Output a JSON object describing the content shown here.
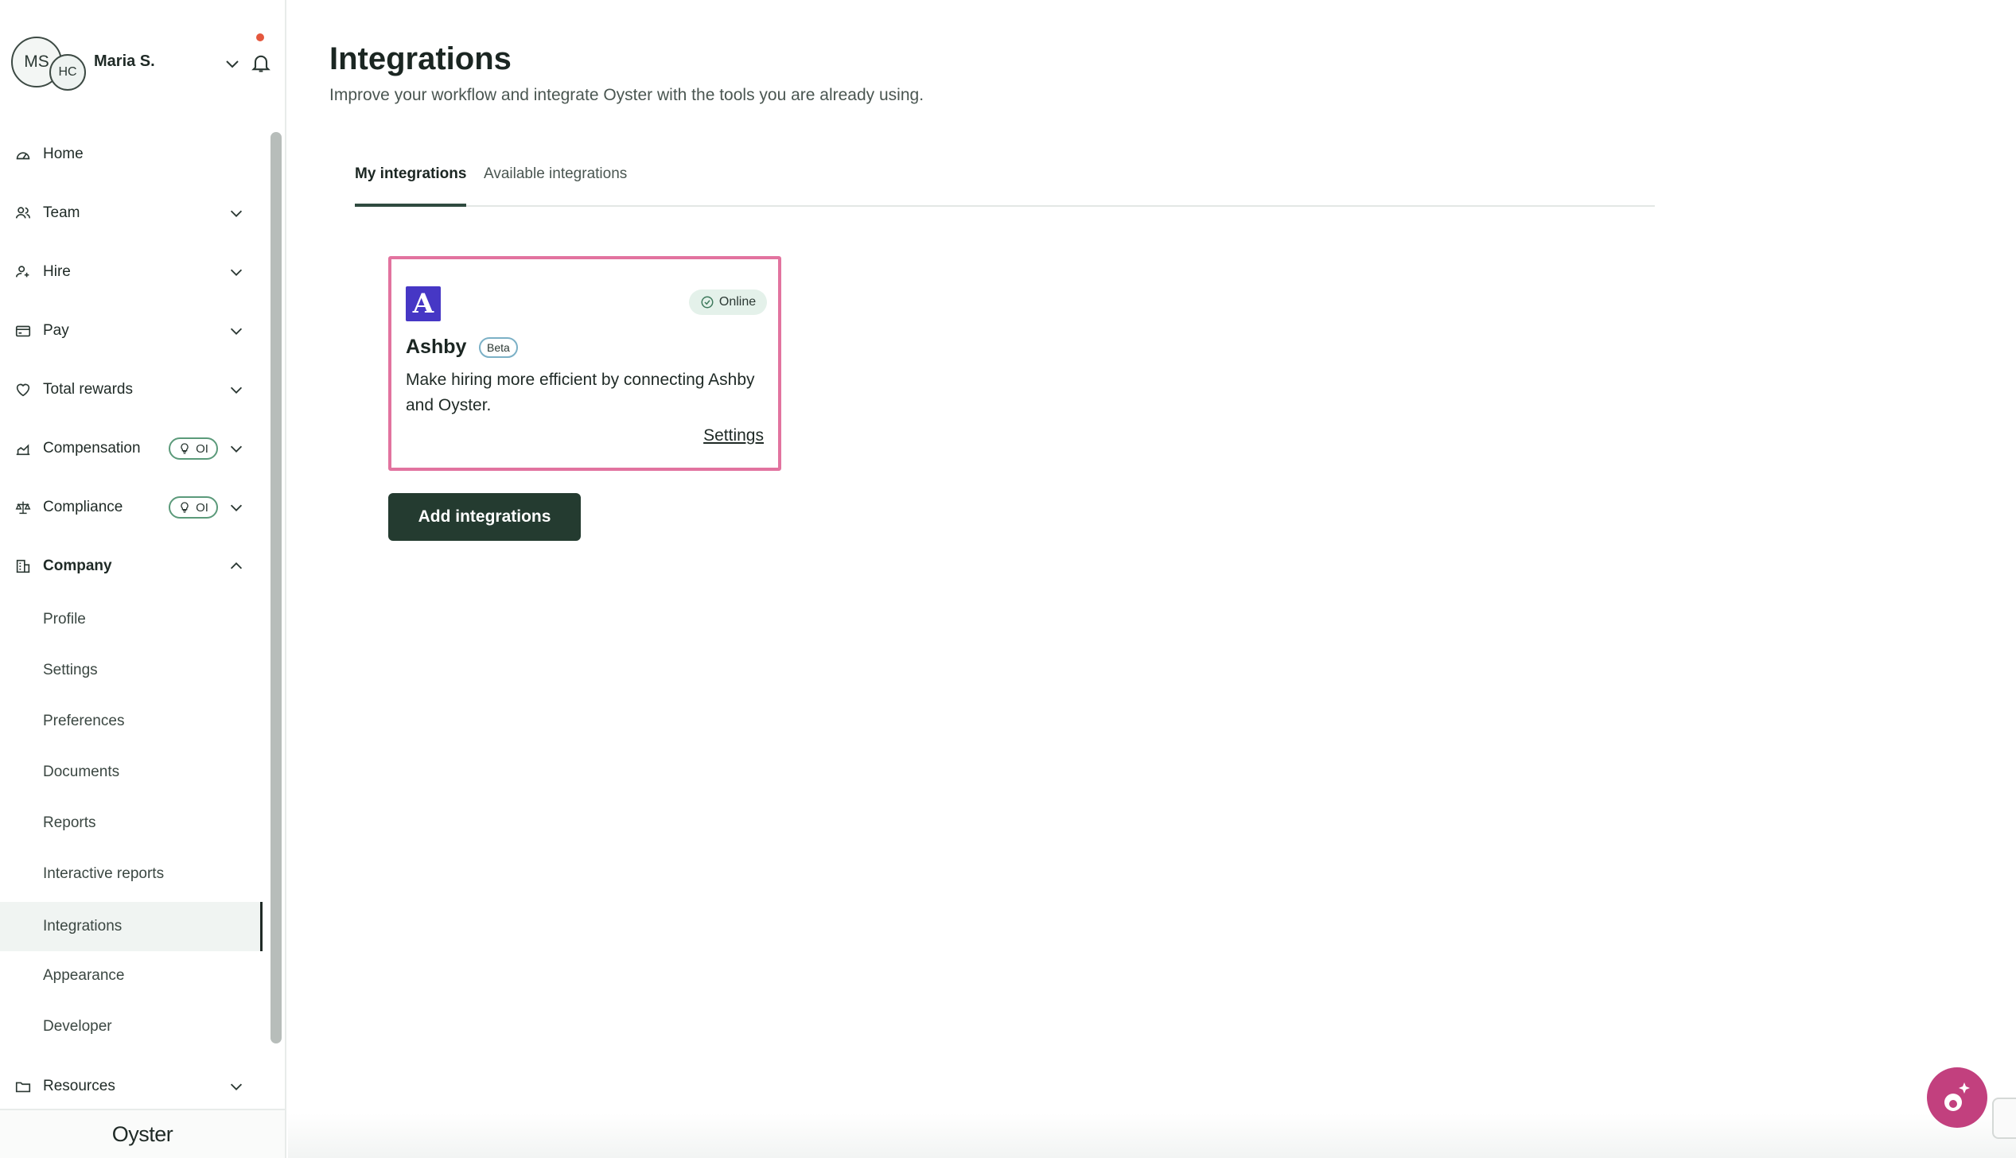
{
  "user": {
    "initials": "MS",
    "company_initials": "HC",
    "name": "Maria S."
  },
  "sidebar": {
    "items": [
      {
        "label": "Home",
        "icon": "home-icon"
      },
      {
        "label": "Team",
        "icon": "team-icon"
      },
      {
        "label": "Hire",
        "icon": "hire-icon"
      },
      {
        "label": "Pay",
        "icon": "pay-icon"
      },
      {
        "label": "Total rewards",
        "icon": "heart-icon"
      },
      {
        "label": "Compensation",
        "icon": "compensation-icon",
        "badge": "OI"
      },
      {
        "label": "Compliance",
        "icon": "scale-icon",
        "badge": "OI"
      },
      {
        "label": "Company",
        "icon": "building-icon"
      }
    ],
    "company_subitems": [
      "Profile",
      "Settings",
      "Preferences",
      "Documents",
      "Reports",
      "Interactive reports",
      "Integrations",
      "Appearance",
      "Developer"
    ],
    "active_subitem": "Integrations",
    "resources": {
      "label": "Resources",
      "icon": "folder-icon"
    },
    "brand": "Oyster"
  },
  "page": {
    "title": "Integrations",
    "subtitle": "Improve your workflow and integrate Oyster with the tools you are already using."
  },
  "tabs": [
    {
      "label": "My integrations",
      "active": true
    },
    {
      "label": "Available integrations",
      "active": false
    }
  ],
  "integration_card": {
    "logo_letter": "A",
    "name": "Ashby",
    "tag": "Beta",
    "status": "Online",
    "description": "Make hiring more efficient by connecting Ashby and Oyster.",
    "settings_label": "Settings",
    "logo_color": "#4637C5",
    "highlight_color": "#E2739F"
  },
  "add_button_label": "Add integrations",
  "colors": {
    "primary": "#243B30",
    "fab": "#C2407E",
    "status_bg": "#E4F1EA"
  }
}
